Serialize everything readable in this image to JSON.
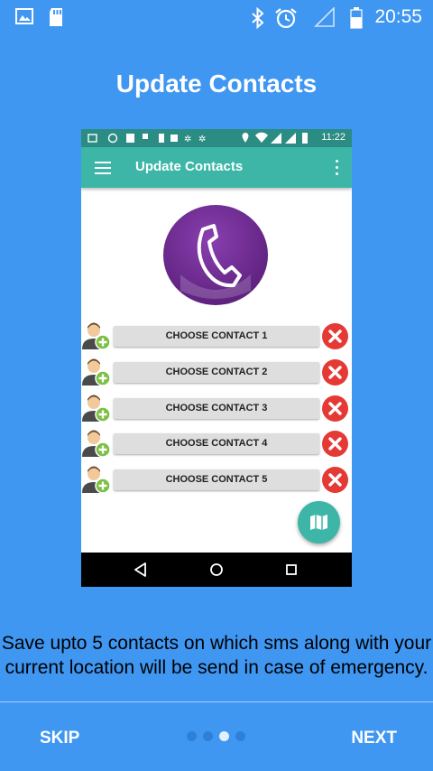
{
  "status_bar": {
    "time": "20:55",
    "left_icons": [
      "image-icon",
      "sd-card-icon"
    ],
    "right_icons": [
      "bluetooth-icon",
      "alarm-icon",
      "signal-icon",
      "battery-icon"
    ]
  },
  "title": "Update Contacts",
  "phone": {
    "status_time": "11:22",
    "app_bar_title": "Update Contacts",
    "contacts": [
      {
        "label": "CHOOSE CONTACT 1"
      },
      {
        "label": "CHOOSE CONTACT 2"
      },
      {
        "label": "CHOOSE CONTACT 3"
      },
      {
        "label": "CHOOSE CONTACT 4"
      },
      {
        "label": "CHOOSE CONTACT 5"
      }
    ]
  },
  "description": "Save upto 5 contacts on which sms along with your current location will be send in case of emergency.",
  "bottom": {
    "skip": "SKIP",
    "next": "NEXT",
    "page_count": 4,
    "current_page": 3
  },
  "colors": {
    "background": "#3f97f2",
    "app_bar": "#3db6a8",
    "remove": "#e53935",
    "logo": "#6f2a93",
    "dot_active": "#ffffff",
    "dot_inactive": "#2f7fd6"
  }
}
